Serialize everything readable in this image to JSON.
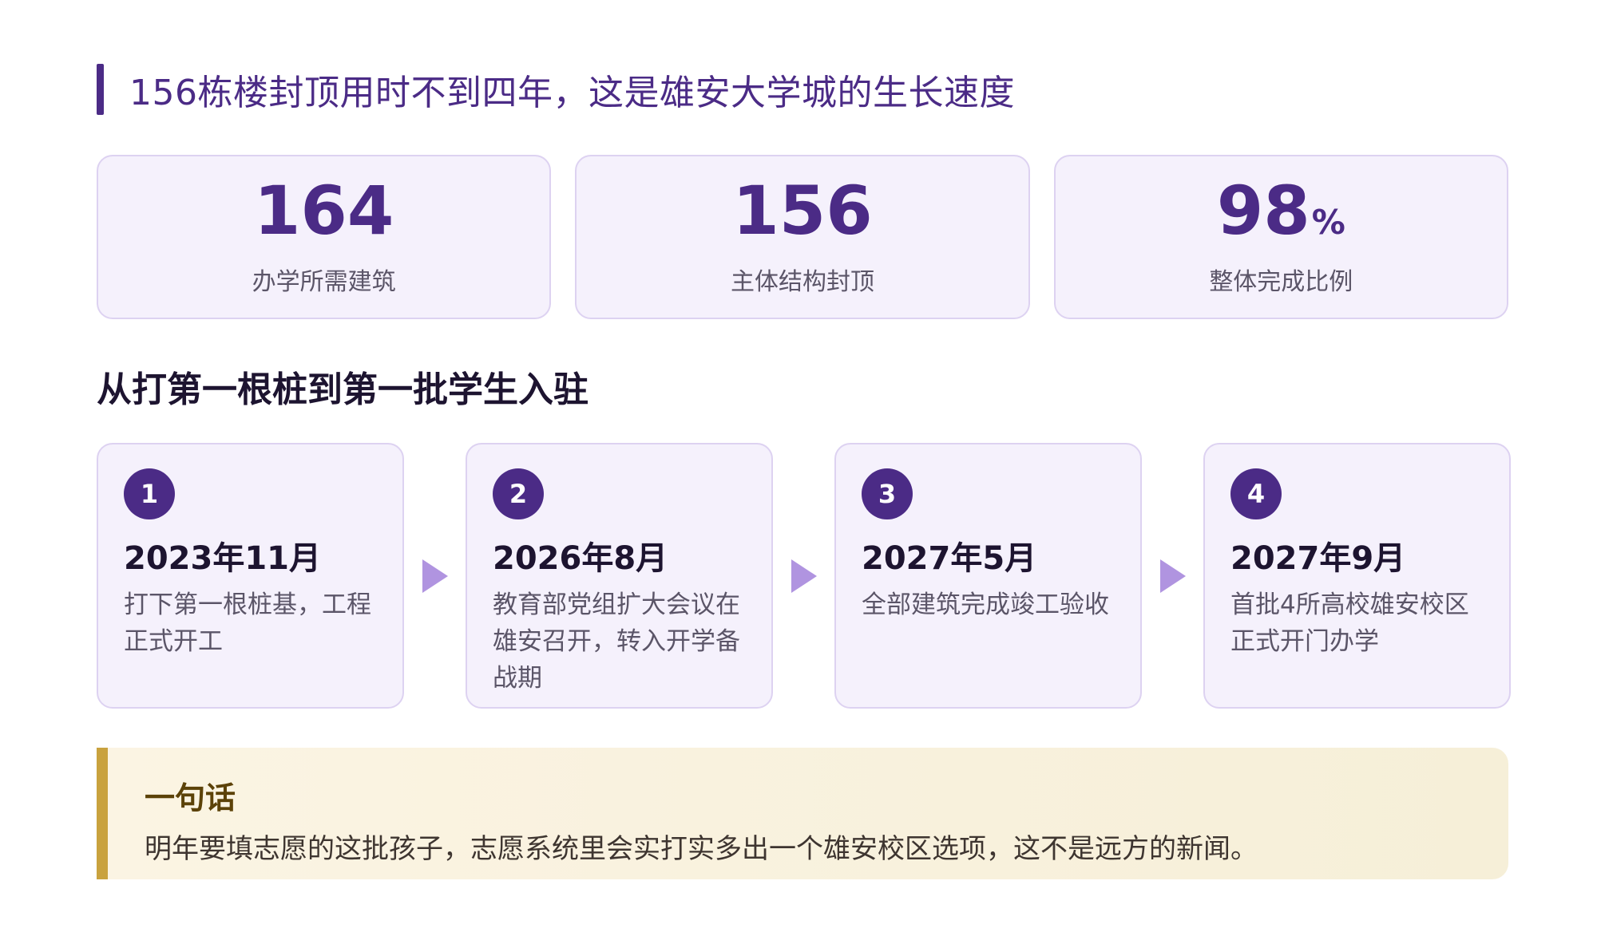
{
  "header": {
    "title": "156栋楼封顶用时不到四年，这是雄安大学城的生长速度"
  },
  "stats": [
    {
      "value": "164",
      "unit": "",
      "label": "办学所需建筑"
    },
    {
      "value": "156",
      "unit": "",
      "label": "主体结构封顶"
    },
    {
      "value": "98",
      "unit": "%",
      "label": "整体完成比例"
    }
  ],
  "section_title": "从打第一根桩到第一批学生入驻",
  "timeline": [
    {
      "num": "1",
      "date": "2023年11月",
      "desc": "打下第一根桩基，工程正式开工"
    },
    {
      "num": "2",
      "date": "2026年8月",
      "desc": "教育部党组扩大会议在雄安召开，转入开学备战期"
    },
    {
      "num": "3",
      "date": "2027年5月",
      "desc": "全部建筑完成竣工验收"
    },
    {
      "num": "4",
      "date": "2027年9月",
      "desc": "首批4所高校雄安校区正式开门办学"
    }
  ],
  "note": {
    "title": "一句话",
    "text": "明年要填志愿的这批孩子，志愿系统里会实打实多出一个雄安校区选项，这不是远方的新闻。"
  },
  "colors": {
    "accent": "#4b2b86",
    "card_bg": "#f5f1fc",
    "card_border": "#ddd2f1",
    "arrow": "#b094e0",
    "note_bar": "#c9a23e",
    "note_bg": "#fbf4e3"
  }
}
